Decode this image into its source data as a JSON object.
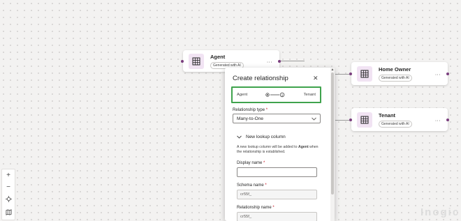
{
  "cards": {
    "agent": {
      "name": "Agent",
      "badge": "Generated with AI",
      "more": "..."
    },
    "home_owner": {
      "name": "Home Owner",
      "badge": "Generated with AI",
      "more": "..."
    },
    "tenant": {
      "name": "Tenant",
      "badge": "Generated with AI",
      "more": "..."
    }
  },
  "zoom": {
    "zoom_in": "+",
    "zoom_out": "−",
    "fit": "⌖",
    "map": "⛉"
  },
  "dialog": {
    "title": "Create relationship",
    "close": "✕",
    "relationship": {
      "from": "Agent",
      "to": "Tenant"
    },
    "type_label": "Relationship type",
    "type_value": "Many-to-One",
    "required_mark": "*",
    "lookup_toggle": "New lookup column",
    "lookup_desc_pre": "A new lookup column will be added to ",
    "lookup_desc_entity": "Agent",
    "lookup_desc_post": " when the relationship is established.",
    "display_name_label": "Display name",
    "display_name_value": "",
    "schema_name_label": "Schema name",
    "schema_name_value": "cr55f_",
    "relationship_name_label": "Relationship name",
    "relationship_name_value": "cr55f_"
  },
  "watermark": "Inogic",
  "colors": {
    "accent_border": "#3fa34d",
    "entity_icon_bg": "#f1e3f3",
    "connector_dot": "#7a3e7e"
  }
}
